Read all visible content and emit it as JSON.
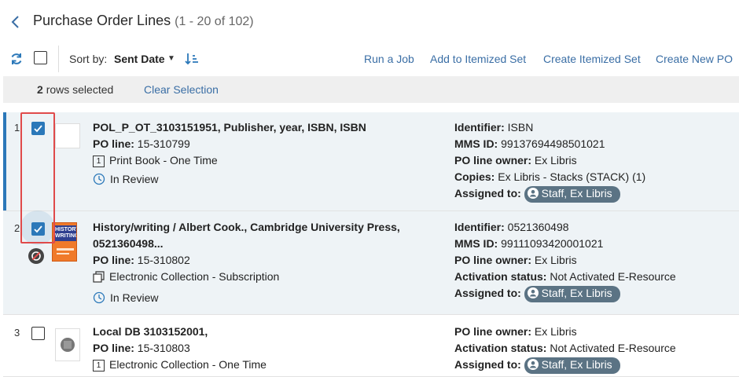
{
  "header": {
    "title": "Purchase Order Lines",
    "range": "(1 - 20 of 102)"
  },
  "toolbar": {
    "sort_label": "Sort by:",
    "sort_value": "Sent Date",
    "links": [
      "Run a Job",
      "Add to Itemized Set",
      "Create Itemized Set",
      "Create New PO"
    ]
  },
  "selection": {
    "count": "2",
    "label": "rows selected",
    "clear": "Clear Selection"
  },
  "rows": [
    {
      "num": "1",
      "title": "POL_P_OT_3103151951, Publisher, year, ISBN, ISBN",
      "po_line_label": "PO line:",
      "po_line": "15-310799",
      "type_num": "1",
      "type": "Print Book - One Time",
      "status": "In Review",
      "side": [
        {
          "label": "Identifier:",
          "value": "ISBN"
        },
        {
          "label": "MMS ID:",
          "value": "99137694498501021"
        },
        {
          "label": "PO line owner:",
          "value": "Ex Libris"
        },
        {
          "label": "Copies:",
          "value": "Ex Libris - Stacks (STACK) (1)"
        }
      ],
      "assigned_label": "Assigned to:",
      "assigned": "Staff, Ex Libris"
    },
    {
      "num": "2",
      "title_1": "History/writing / Albert Cook., Cambridge University Press,",
      "title_2": "0521360498...",
      "cover_text": "HISTORY/ WRITING",
      "po_line_label": "PO line:",
      "po_line": "15-310802",
      "type": "Electronic Collection - Subscription",
      "status": "In Review",
      "side": [
        {
          "label": "Identifier:",
          "value": "0521360498"
        },
        {
          "label": "MMS ID:",
          "value": "99111093420001021"
        },
        {
          "label": "PO line owner:",
          "value": "Ex Libris"
        },
        {
          "label": "Activation status:",
          "value": "Not Activated E-Resource"
        }
      ],
      "assigned_label": "Assigned to:",
      "assigned": "Staff, Ex Libris"
    },
    {
      "num": "3",
      "title": "Local DB 3103152001,",
      "po_line_label": "PO line:",
      "po_line": "15-310803",
      "type_num": "1",
      "type": "Electronic Collection - One Time",
      "side": [
        {
          "label": "PO line owner:",
          "value": "Ex Libris"
        },
        {
          "label": "Activation status:",
          "value": "Not Activated E-Resource"
        }
      ],
      "assigned_label": "Assigned to:",
      "assigned": "Staff, Ex Libris"
    }
  ],
  "colors": {
    "accent": "#2b78b9",
    "link": "#3a6ea5",
    "pill": "#5b7384",
    "highlight": "#e04a4a"
  }
}
